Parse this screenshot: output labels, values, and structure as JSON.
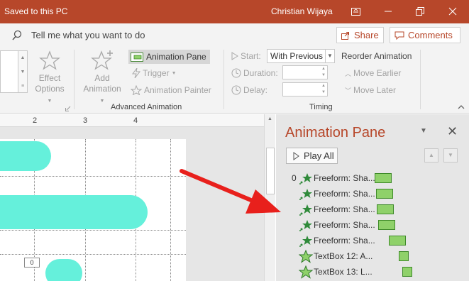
{
  "window": {
    "status": "Saved to this PC",
    "user_name": "Christian Wijaya"
  },
  "tellbar": {
    "placeholder": "Tell me what you want to do",
    "share_label": "Share",
    "comments_label": "Comments"
  },
  "ribbon": {
    "effect_options": [
      "Effect",
      "Options"
    ],
    "add_animation": [
      "Add",
      "Animation"
    ],
    "animation_pane_label": "Animation Pane",
    "trigger_label": "Trigger",
    "animation_painter_label": "Animation Painter",
    "advanced_group_label": "Advanced Animation",
    "start_label": "Start:",
    "start_value": "With Previous",
    "duration_label": "Duration:",
    "delay_label": "Delay:",
    "timing_group_label": "Timing",
    "reorder_label": "Reorder Animation",
    "move_earlier_label": "Move Earlier",
    "move_later_label": "Move Later"
  },
  "ruler": {
    "ticks": [
      "2",
      "3",
      "4"
    ]
  },
  "slide": {
    "anim_tag": "0"
  },
  "animation_pane": {
    "title": "Animation Pane",
    "play_all_label": "Play All",
    "items": [
      {
        "num": "0",
        "label": "Freeform: Sha...",
        "kind": "motion"
      },
      {
        "num": "",
        "label": "Freeform: Sha...",
        "kind": "motion"
      },
      {
        "num": "",
        "label": "Freeform: Sha...",
        "kind": "motion"
      },
      {
        "num": "",
        "label": "Freeform: Sha...",
        "kind": "motion"
      },
      {
        "num": "",
        "label": "Freeform: Sha...",
        "kind": "motion"
      },
      {
        "num": "",
        "label": "TextBox 12: A...",
        "kind": "entrance"
      },
      {
        "num": "",
        "label": "TextBox 13: L...",
        "kind": "entrance"
      }
    ]
  },
  "colors": {
    "brand": "#b7472a",
    "shape_fill": "#65f0db",
    "timeline_bar": "#8fd16a",
    "arrow": "#e8201c"
  }
}
